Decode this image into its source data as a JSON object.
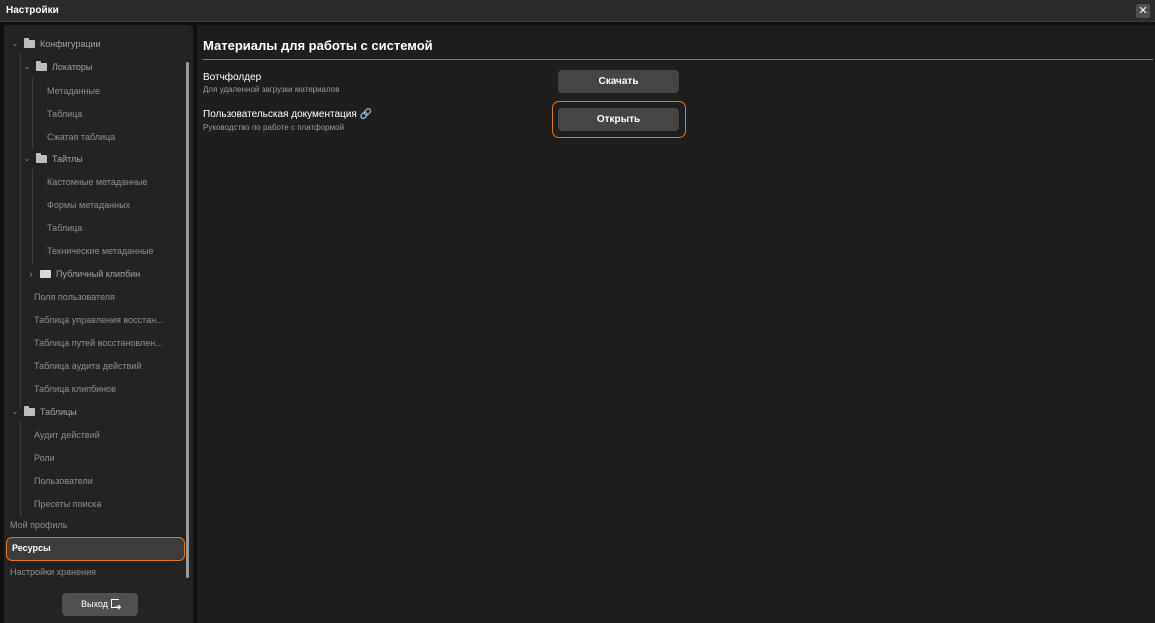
{
  "window": {
    "title": "Настройки",
    "close_glyph": "✕"
  },
  "sidebar": {
    "tree": [
      {
        "label": "Конфигурации",
        "type": "folder-open",
        "icon": "folder-open-icon"
      },
      {
        "label": "Локаторы",
        "type": "folder-open",
        "icon": "folder-open-icon"
      },
      {
        "label": "Метаданные",
        "type": "item"
      },
      {
        "label": "Таблица",
        "type": "item"
      },
      {
        "label": "Сжатая таблица",
        "type": "item"
      },
      {
        "label": "Тайтлы",
        "type": "folder-open",
        "icon": "folder-open-icon"
      },
      {
        "label": "Кастомные метаданные",
        "type": "item"
      },
      {
        "label": "Формы метаданных",
        "type": "item"
      },
      {
        "label": "Таблица",
        "type": "item"
      },
      {
        "label": "Технические метаданные",
        "type": "item"
      },
      {
        "label": "Публичный клипбин",
        "type": "folder-closed",
        "icon": "folder-closed-icon"
      },
      {
        "label": "Поля пользователя",
        "type": "item"
      },
      {
        "label": "Таблица управления восстан...",
        "type": "item"
      },
      {
        "label": "Таблица путей восстановлен...",
        "type": "item"
      },
      {
        "label": "Таблица аудита действий",
        "type": "item"
      },
      {
        "label": "Таблица клипбинов",
        "type": "item"
      },
      {
        "label": "Таблицы",
        "type": "folder-open",
        "icon": "folder-open-icon"
      },
      {
        "label": "Аудит действий",
        "type": "item"
      },
      {
        "label": "Роли",
        "type": "item"
      },
      {
        "label": "Пользователи",
        "type": "item"
      },
      {
        "label": "Пресеты поиска",
        "type": "item"
      }
    ],
    "nav": [
      {
        "label": "Мой профиль"
      },
      {
        "label": "Ресурсы",
        "active": true
      },
      {
        "label": "Настройки хранения"
      }
    ],
    "exit_label": "Выход"
  },
  "main": {
    "heading": "Материалы для работы с системой",
    "resources": [
      {
        "title": "Вотчфолдер",
        "subtitle": "Для удаленной загрузки материалов",
        "button": "Скачать",
        "link_icon": false
      },
      {
        "title": "Пользовательская документация",
        "subtitle": "Руководство по работе с платформой",
        "button": "Открыть",
        "link_icon": true,
        "link_glyph": "🔗"
      }
    ]
  },
  "colors": {
    "accent": "#e8741c",
    "background": "#111111",
    "panel": "#1e1e1e",
    "sidebar": "#232323",
    "button": "#454545"
  }
}
